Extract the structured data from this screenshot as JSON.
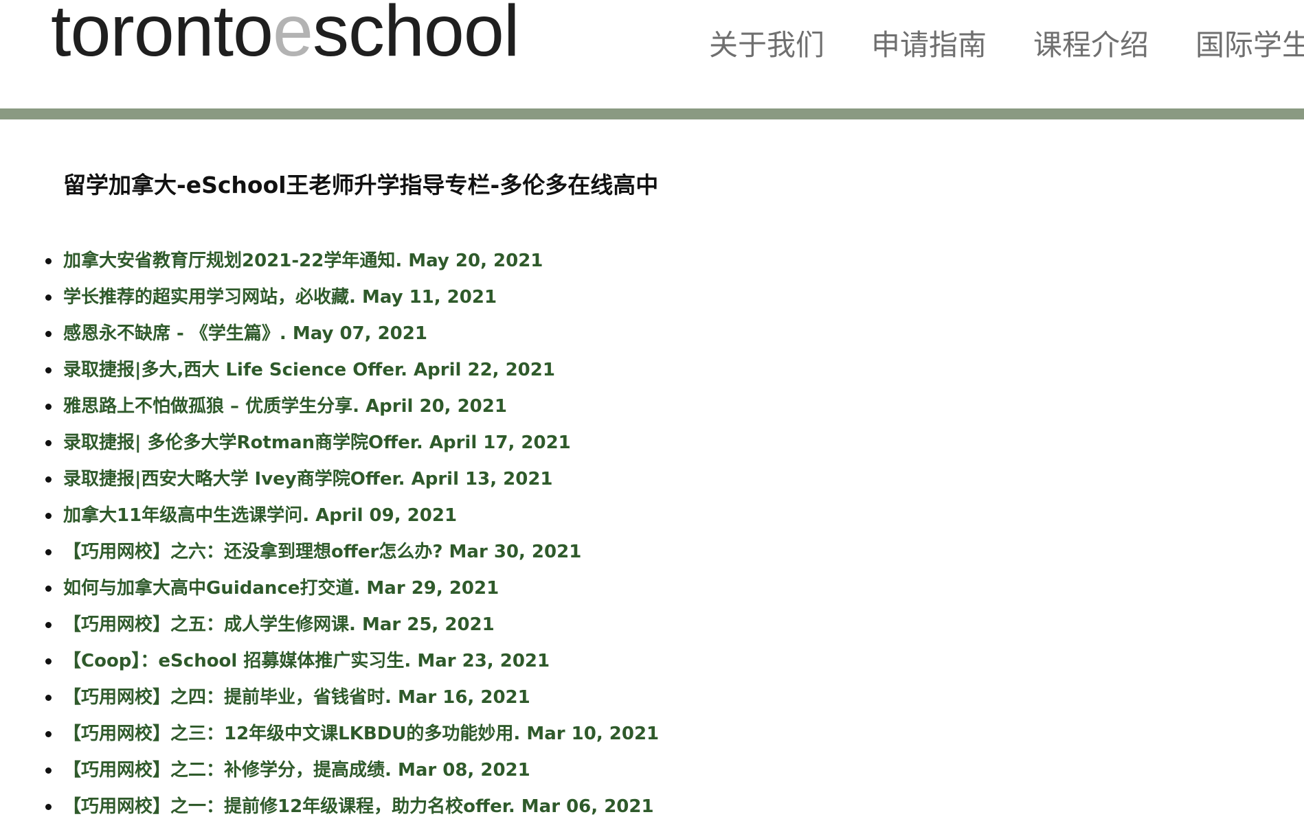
{
  "logo": {
    "part1": "toronto",
    "part2": "e",
    "part3": "school"
  },
  "nav": {
    "items": [
      "关于我们",
      "申请指南",
      "课程介绍",
      "国际学生"
    ]
  },
  "page": {
    "title": "留学加拿大-eSchool王老师升学指导专栏-多伦多在线高中"
  },
  "posts": [
    {
      "title": "加拿大安省教育厅规划2021-22学年通知",
      "date": "May 20, 2021"
    },
    {
      "title": "学长推荐的超实用学习网站，必收藏",
      "date": "May 11, 2021"
    },
    {
      "title": "感恩永不缺席 - 《学生篇》",
      "date": "May 07, 2021"
    },
    {
      "title": "录取捷报|多大,西大 Life Science Offer",
      "date": "April 22, 2021"
    },
    {
      "title": "雅思路上不怕做孤狼 – 优质学生分享",
      "date": "April 20, 2021"
    },
    {
      "title": "录取捷报| 多伦多大学Rotman商学院Offer",
      "date": "April 17, 2021"
    },
    {
      "title": "录取捷报|西安大略大学 Ivey商学院Offer",
      "date": "April 13, 2021"
    },
    {
      "title": "加拿大11年级高中生选课学问",
      "date": "April 09, 2021"
    },
    {
      "title": "【巧用网校】之六：还没拿到理想offer怎么办?",
      "date": "Mar 30, 2021"
    },
    {
      "title": "如何与加拿大高中Guidance打交道",
      "date": "Mar 29, 2021"
    },
    {
      "title": "【巧用网校】之五：成人学生修网课",
      "date": "Mar 25, 2021"
    },
    {
      "title": "【Coop】：eSchool 招募媒体推广实习生",
      "date": "Mar 23, 2021"
    },
    {
      "title": "【巧用网校】之四：提前毕业，省钱省时",
      "date": "Mar 16, 2021"
    },
    {
      "title": "【巧用网校】之三：12年级中文课LKBDU的多功能妙用",
      "date": "Mar 10, 2021"
    },
    {
      "title": "【巧用网校】之二：补修学分，提高成绩",
      "date": "Mar 08, 2021"
    },
    {
      "title": "【巧用网校】之一：提前修12年级课程，助力名校offer",
      "date": "Mar 06, 2021"
    }
  ]
}
